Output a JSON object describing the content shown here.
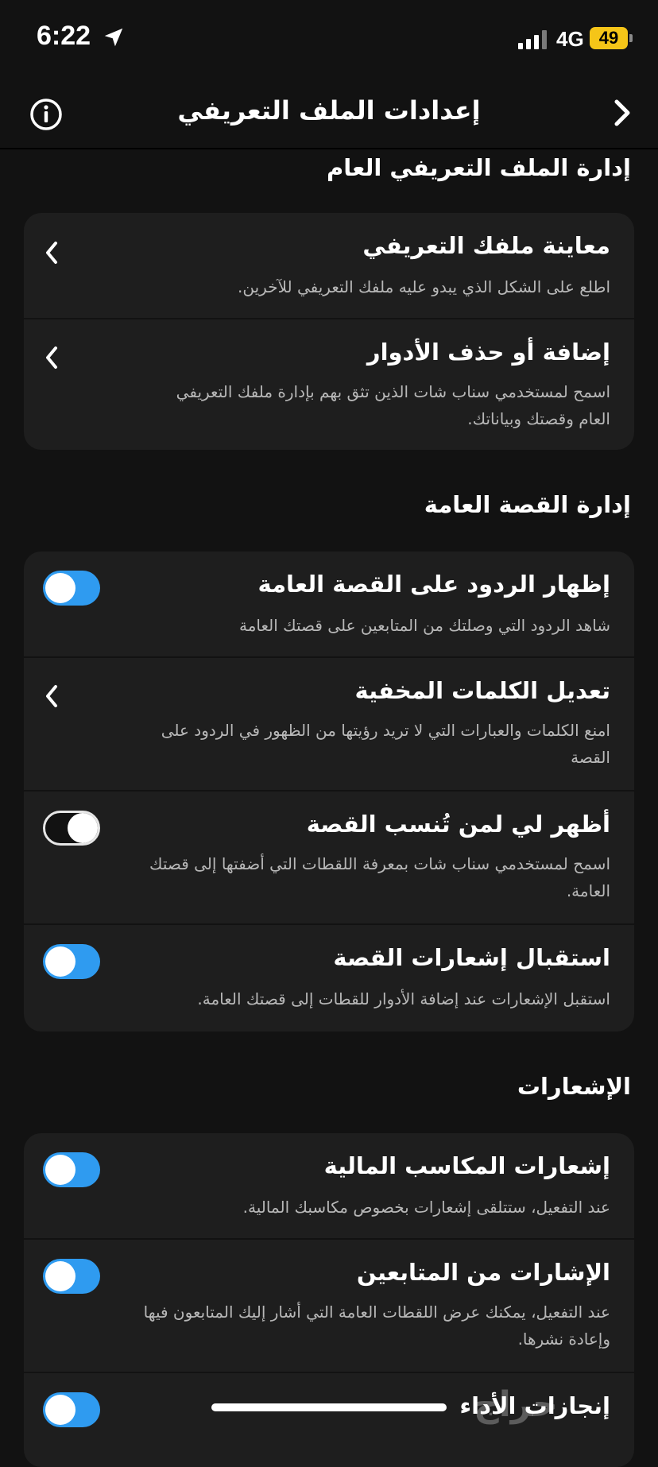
{
  "status": {
    "time": "6:22",
    "network": "4G",
    "battery": "49"
  },
  "header": {
    "title": "إعدادات الملف التعريفي"
  },
  "sections": {
    "profile": {
      "title": "إدارة الملف التعريفي العام",
      "rows": [
        {
          "title": "معاينة ملفك التعريفي",
          "desc": "اطلع على الشكل الذي يبدو عليه ملفك التعريفي للآخرين."
        },
        {
          "title": "إضافة أو حذف الأدوار",
          "desc": "اسمح لمستخدمي سناب شات الذين تثق بهم بإدارة ملفك التعريفي العام وقصتك وبياناتك."
        }
      ]
    },
    "story": {
      "title": "إدارة القصة العامة",
      "rows": [
        {
          "title": "إظهار الردود على القصة العامة",
          "desc": "شاهد الردود التي وصلتك من المتابعين على قصتك العامة",
          "toggle": "on"
        },
        {
          "title": "تعديل الكلمات المخفية",
          "desc": "امنع الكلمات والعبارات التي لا تريد رؤيتها من الظهور في الردود على القصة"
        },
        {
          "title": "أظهر لي لمن تُنسب القصة",
          "desc": "اسمح لمستخدمي سناب شات بمعرفة اللقطات التي أضفتها إلى قصتك العامة.",
          "toggle": "off"
        },
        {
          "title": "استقبال إشعارات القصة",
          "desc": "استقبل الإشعارات عند إضافة الأدوار للقطات إلى قصتك العامة.",
          "toggle": "on"
        }
      ]
    },
    "notifications": {
      "title": "الإشعارات",
      "rows": [
        {
          "title": "إشعارات المكاسب المالية",
          "desc": "عند التفعيل، ستتلقى إشعارات بخصوص مكاسبك المالية.",
          "toggle": "on"
        },
        {
          "title": "الإشارات من المتابعين",
          "desc": "عند التفعيل، يمكنك عرض اللقطات العامة التي أشار إليك المتابعون فيها وإعادة نشرها.",
          "toggle": "on"
        },
        {
          "title": "إنجازات الأداء",
          "toggle": "on"
        }
      ]
    }
  },
  "watermark": "حراج",
  "colors": {
    "background": "#121212",
    "card": "#1e1e1e",
    "toggle_on": "#2f9bf0",
    "battery": "#f5c518"
  }
}
